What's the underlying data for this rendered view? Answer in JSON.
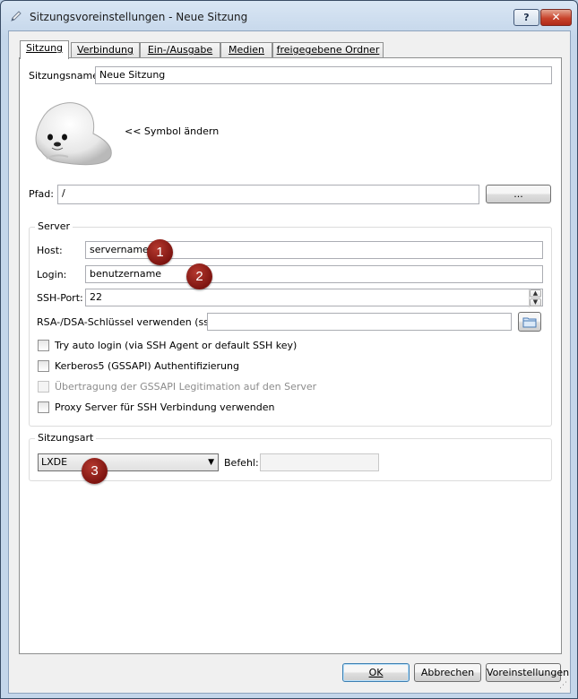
{
  "window": {
    "title": "Sitzungsvoreinstellungen - Neue Sitzung",
    "help_label": "?",
    "close_label": "✕"
  },
  "tabs": [
    "Sitzung",
    "Verbindung",
    "Ein-/Ausgabe",
    "Medien",
    "freigegebene Ordner"
  ],
  "session": {
    "name_label": "Sitzungsname:",
    "name_value": "Neue Sitzung",
    "change_icon_label": "<< Symbol ändern",
    "path_label": "Pfad:",
    "path_value": "/",
    "browse_label": "..."
  },
  "server": {
    "group_title": "Server",
    "host_label": "Host:",
    "host_value": "servername",
    "login_label": "Login:",
    "login_value": "benutzername",
    "port_label": "SSH-Port:",
    "port_value": "22",
    "key_label": "RSA-/DSA-Schlüssel verwenden (ssh):",
    "key_value": "",
    "checkboxes": [
      {
        "label": "Try auto login (via SSH Agent or default SSH key)",
        "checked": false,
        "enabled": true
      },
      {
        "label": "Kerberos5 (GSSAPI) Authentifizierung",
        "checked": false,
        "enabled": true
      },
      {
        "label": "Übertragung der GSSAPI Legitimation auf den Server",
        "checked": false,
        "enabled": false
      },
      {
        "label": "Proxy Server für SSH Verbindung verwenden",
        "checked": false,
        "enabled": true
      }
    ]
  },
  "session_type": {
    "group_title": "Sitzungsart",
    "selected": "LXDE",
    "command_label": "Befehl:",
    "command_value": ""
  },
  "badges": [
    "1",
    "2",
    "3"
  ],
  "buttons": {
    "ok": "OK",
    "cancel": "Abbrechen",
    "defaults": "Voreinstellungen"
  },
  "colors": {
    "badge": "#8b1a14",
    "titlebar": "#c4d6ea"
  }
}
